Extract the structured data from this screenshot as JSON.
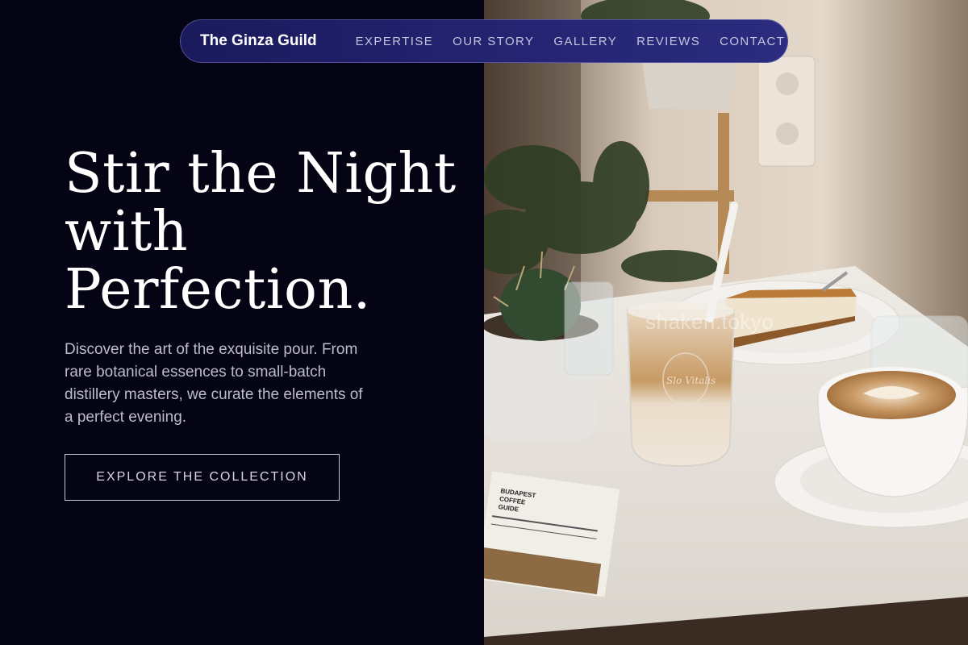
{
  "nav": {
    "brand": "The Ginza Guild",
    "links": [
      "EXPERTISE",
      "OUR STORY",
      "GALLERY",
      "REVIEWS",
      "CONTACT"
    ]
  },
  "hero": {
    "title_lines": [
      "Stir the Night",
      "with",
      "Perfection."
    ],
    "description_lines": [
      "Discover the art of the exquisite pour. From",
      "rare botanical essences to small-batch",
      "distillery masters, we curate the elements of",
      "a perfect evening."
    ],
    "cta_label": "EXPLORE THE COLLECTION"
  },
  "photo": {
    "watermark": "shaken.tokyo",
    "card_lines": [
      "BUDAPEST",
      "COFFEE",
      "GUIDE"
    ],
    "glass_script": "Slo Vitalis"
  },
  "colors": {
    "background": "#050414",
    "nav_background": "#232370",
    "text_primary": "#ffffff",
    "text_secondary": "#bcbccb"
  }
}
